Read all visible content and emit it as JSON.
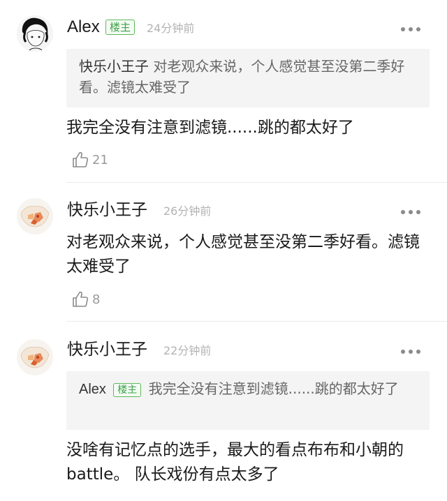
{
  "comments": [
    {
      "author": "Alex",
      "badge": "楼主",
      "time": "24分钟前",
      "quote": {
        "author": "快乐小王子",
        "text": "对老观众来说，个人感觉甚至没第二季好看。滤镜太难受了"
      },
      "text": "我完全没有注意到滤镜......跳的都太好了",
      "likes": "21"
    },
    {
      "author": "快乐小王子",
      "time": "26分钟前",
      "text": "对老观众来说，个人感觉甚至没第二季好看。滤镜太难受了",
      "likes": "8"
    },
    {
      "author": "快乐小王子",
      "time": "22分钟前",
      "quote": {
        "author": "Alex",
        "badge": "楼主",
        "text": "我完全没有注意到滤镜......跳的都太好了"
      },
      "text": "没啥有记忆点的选手，最大的看点布布和小朝的battle。 队长戏份有点太多了"
    }
  ],
  "icons": {
    "more": "more-dots-icon",
    "like": "thumbs-up-icon"
  },
  "colors": {
    "badge": "#3fa14a",
    "quote_bg": "#f4f4f4",
    "time": "#b3b3b3"
  }
}
